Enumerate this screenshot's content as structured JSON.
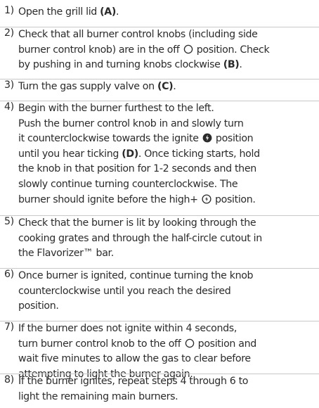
{
  "steps": [
    {
      "number": "1)",
      "lines": [
        [
          "Open the grill lid ",
          {
            "b": "(A)"
          },
          "."
        ]
      ]
    },
    {
      "number": "2)",
      "lines": [
        [
          "Check that all burner control knobs (including side"
        ],
        [
          "burner control knob) are in the off ",
          {
            "icon": "off-circle-icon"
          },
          " position. Check"
        ],
        [
          "by pushing in and turning knobs clockwise ",
          {
            "b": "(B)"
          },
          "."
        ]
      ]
    },
    {
      "number": "3)",
      "lines": [
        [
          "Turn the gas supply valve on ",
          {
            "b": "(C)"
          },
          "."
        ]
      ]
    },
    {
      "number": "4)",
      "lines": [
        [
          "Begin with the burner furthest to the left."
        ],
        [
          "Push the burner control knob in and slowly turn"
        ],
        [
          "it counterclockwise towards the ignite ",
          {
            "icon": "ignite-icon"
          },
          " position"
        ],
        [
          "until you hear ticking ",
          {
            "b": "(D)"
          },
          ". Once ticking starts, hold"
        ],
        [
          "the knob in that position for 1-2 seconds and then"
        ],
        [
          "slowly continue turning counterclockwise. The"
        ],
        [
          "burner should ignite before the high+ ",
          {
            "icon": "high-plus-icon"
          },
          " position."
        ]
      ]
    },
    {
      "number": "5)",
      "lines": [
        [
          "Check that the burner is lit by looking through the"
        ],
        [
          "cooking grates and through the half-circle cutout in"
        ],
        [
          "the Flavorizer™ bar."
        ]
      ]
    },
    {
      "number": "6)",
      "lines": [
        [
          "Once burner is ignited, continue turning the knob"
        ],
        [
          "counterclockwise until you reach the desired"
        ],
        [
          "position."
        ]
      ]
    },
    {
      "number": "7)",
      "lines": [
        [
          "If the burner does not ignite within 4 seconds,"
        ],
        [
          "turn burner control knob to the off ",
          {
            "icon": "off-circle-icon"
          },
          " position and"
        ],
        [
          "wait five minutes to allow the gas to clear before"
        ],
        [
          "attempting to light the burner again."
        ]
      ]
    },
    {
      "number": "8)",
      "lines": [
        [
          "If the burner ignites, repeat steps 4 through 6 to"
        ],
        [
          "light the remaining main burners."
        ]
      ]
    }
  ]
}
